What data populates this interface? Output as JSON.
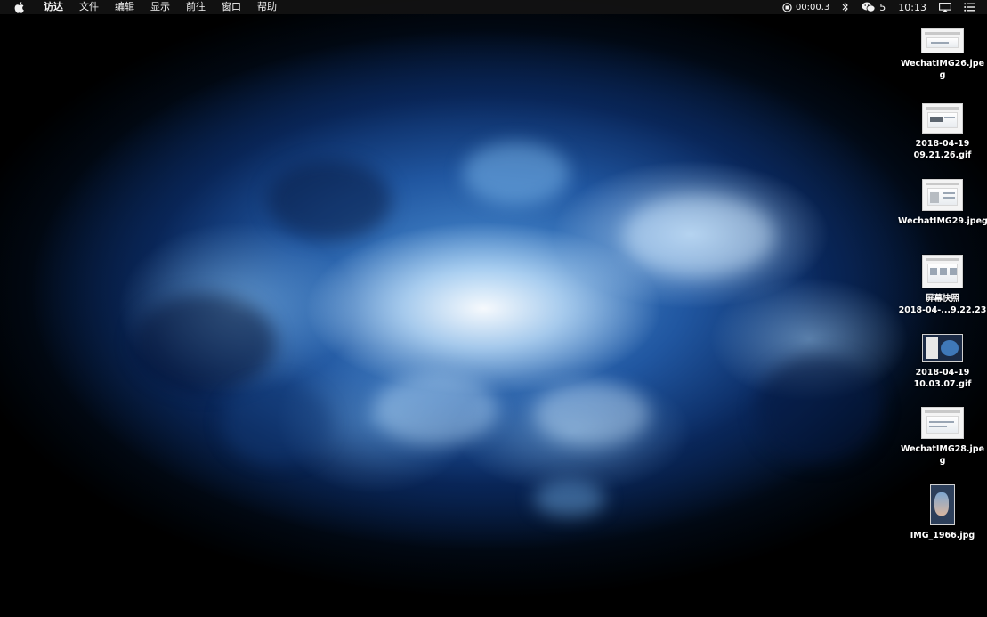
{
  "menubar": {
    "apple_icon": "apple-logo",
    "app_name": "访达",
    "items": [
      "文件",
      "编辑",
      "显示",
      "前往",
      "窗口",
      "帮助"
    ],
    "status": {
      "recording_time": "00:00.3",
      "wechat_count": "5",
      "clock": "10:13"
    }
  },
  "desktop_files": [
    {
      "lines": [
        "WechatIMG26.jpe",
        "g"
      ],
      "kind": "screenshot"
    },
    {
      "lines": [
        "2018-04-19",
        "09.21.26.gif"
      ],
      "kind": "screenshot"
    },
    {
      "lines": [
        "WechatIMG29.jpeg"
      ],
      "kind": "document"
    },
    {
      "lines": [
        "屏幕快照",
        "2018-04-...9.22.23"
      ],
      "kind": "screenshot"
    },
    {
      "lines": [
        "2018-04-19",
        "10.03.07.gif"
      ],
      "kind": "dark-screenshot"
    },
    {
      "lines": [
        "WechatIMG28.jpe",
        "g"
      ],
      "kind": "screenshot"
    },
    {
      "lines": [
        "IMG_1966.jpg"
      ],
      "kind": "photo"
    }
  ],
  "colors": {
    "menubar_bg": "#141414",
    "wallpaper_core": "#cfe6ff",
    "wallpaper_mid": "#2b74c4",
    "wallpaper_edge": "#000000"
  }
}
